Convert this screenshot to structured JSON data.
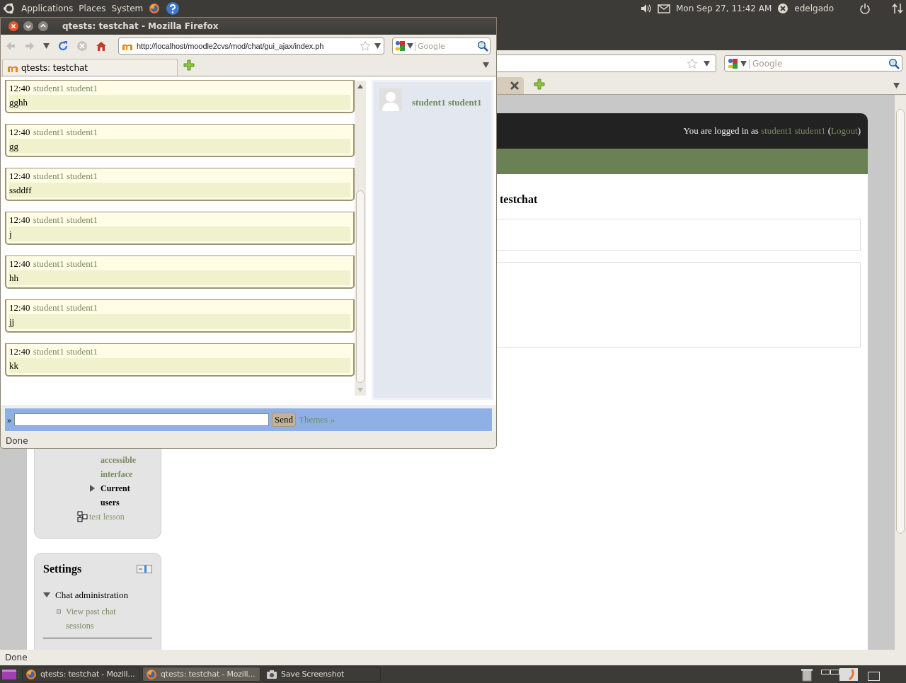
{
  "top_panel": {
    "menus": [
      "Applications",
      "Places",
      "System"
    ],
    "clock": "Mon Sep 27, 11:42 AM",
    "user": "edelgado"
  },
  "main_browser": {
    "search_placeholder": "Google",
    "page": {
      "login": {
        "prefix": "You are logged in as",
        "user": "student1 student1",
        "open": "(",
        "logout": "Logout",
        "close": ")"
      },
      "heading": "testchat",
      "nav_block": {
        "items": [
          {
            "kind": "link",
            "label": "accessible interface"
          },
          {
            "kind": "folder",
            "label": "Current users",
            "expanded": false
          },
          {
            "kind": "activity",
            "label": "test lesson"
          }
        ]
      },
      "settings_block": {
        "title": "Settings",
        "sections": [
          {
            "label": "Chat administration",
            "expanded": true,
            "children": [
              {
                "label": "View past chat sessions"
              }
            ]
          }
        ]
      }
    },
    "status": "Done"
  },
  "popup": {
    "title": "qtests: testchat - Mozilla Firefox",
    "url": "http://localhost/moodle2cvs/mod/chat/gui_ajax/index.ph",
    "search_placeholder": "Google",
    "tab": "qtests: testchat",
    "messages": [
      {
        "time": "12:40",
        "user": "student1 student1",
        "text": "gghh"
      },
      {
        "time": "12:40",
        "user": "student1 student1",
        "text": "gg"
      },
      {
        "time": "12:40",
        "user": "student1 student1",
        "text": "ssddff"
      },
      {
        "time": "12:40",
        "user": "student1 student1",
        "text": "j"
      },
      {
        "time": "12:40",
        "user": "student1 student1",
        "text": "hh"
      },
      {
        "time": "12:40",
        "user": "student1 student1",
        "text": "jj"
      },
      {
        "time": "12:40",
        "user": "student1 student1",
        "text": "kk"
      }
    ],
    "users": [
      {
        "name": "student1 student1"
      }
    ],
    "input": {
      "prompt": "»",
      "send": "Send",
      "themes": "Themes »"
    },
    "status": "Done"
  },
  "taskbar": {
    "tasks": [
      {
        "kind": "firefox",
        "label": "qtests: testchat - Mozill...",
        "selected": false
      },
      {
        "kind": "firefox",
        "label": "qtests: testchat - Mozill...",
        "selected": true
      },
      {
        "kind": "camera",
        "label": "Save Screenshot",
        "selected": false
      }
    ]
  }
}
